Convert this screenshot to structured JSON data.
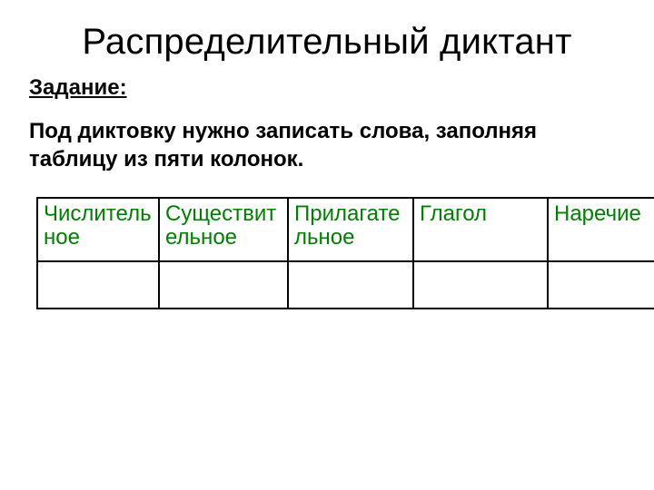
{
  "title": "Распределительный диктант",
  "task_label": "Задание:",
  "instruction": "Под диктовку нужно записать слова, заполняя таблицу  из пяти колонок.",
  "table": {
    "headers": [
      "Числительное",
      "Существительное",
      "Прилагательное",
      "Глагол",
      "Наречие"
    ],
    "rows": [
      [
        "",
        "",
        "",
        "",
        ""
      ]
    ]
  },
  "colors": {
    "header_text": "#008000",
    "border": "#000000"
  }
}
